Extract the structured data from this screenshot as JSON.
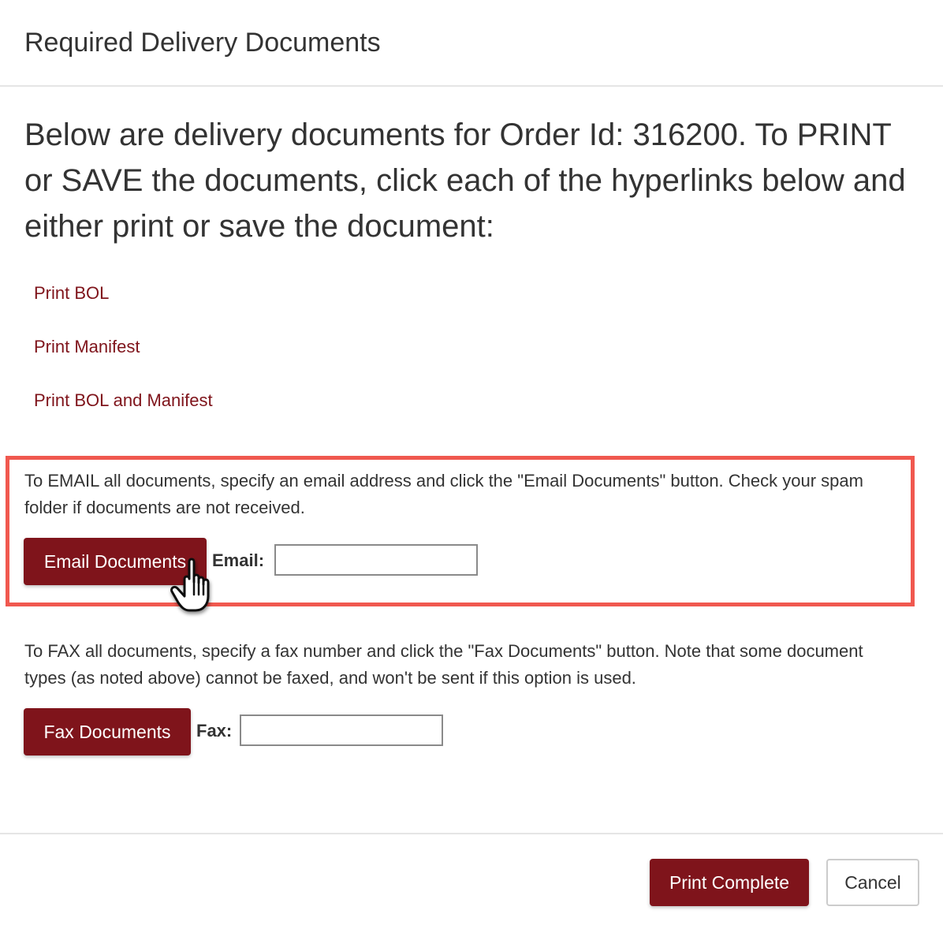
{
  "modal": {
    "title": "Required Delivery Documents"
  },
  "intro": {
    "text": "Below are delivery documents for Order Id: 316200. To PRINT or SAVE the documents, click each of the hyperlinks below and either print or save the document:"
  },
  "links": [
    {
      "label": "Print BOL"
    },
    {
      "label": "Print Manifest"
    },
    {
      "label": "Print BOL and Manifest"
    }
  ],
  "email_section": {
    "help_text": "To EMAIL all documents, specify an email address and click the \"Email Documents\" button. Check your spam folder if documents are not received.",
    "button_label": "Email Documents",
    "field_label": "Email:",
    "field_value": "",
    "highlight_color": "#f0584f"
  },
  "fax_section": {
    "help_text": "To FAX all documents, specify a fax number and click the \"Fax Documents\" button. Note that some document types (as noted above) cannot be faxed, and won't be sent if this option is used.",
    "button_label": "Fax Documents",
    "field_label": "Fax:",
    "field_value": ""
  },
  "footer": {
    "primary_label": "Print Complete",
    "cancel_label": "Cancel"
  },
  "colors": {
    "brand": "#7f141b",
    "text": "#333333",
    "highlight": "#f0584f"
  },
  "icons": {
    "cursor": "hand-pointer-icon"
  }
}
